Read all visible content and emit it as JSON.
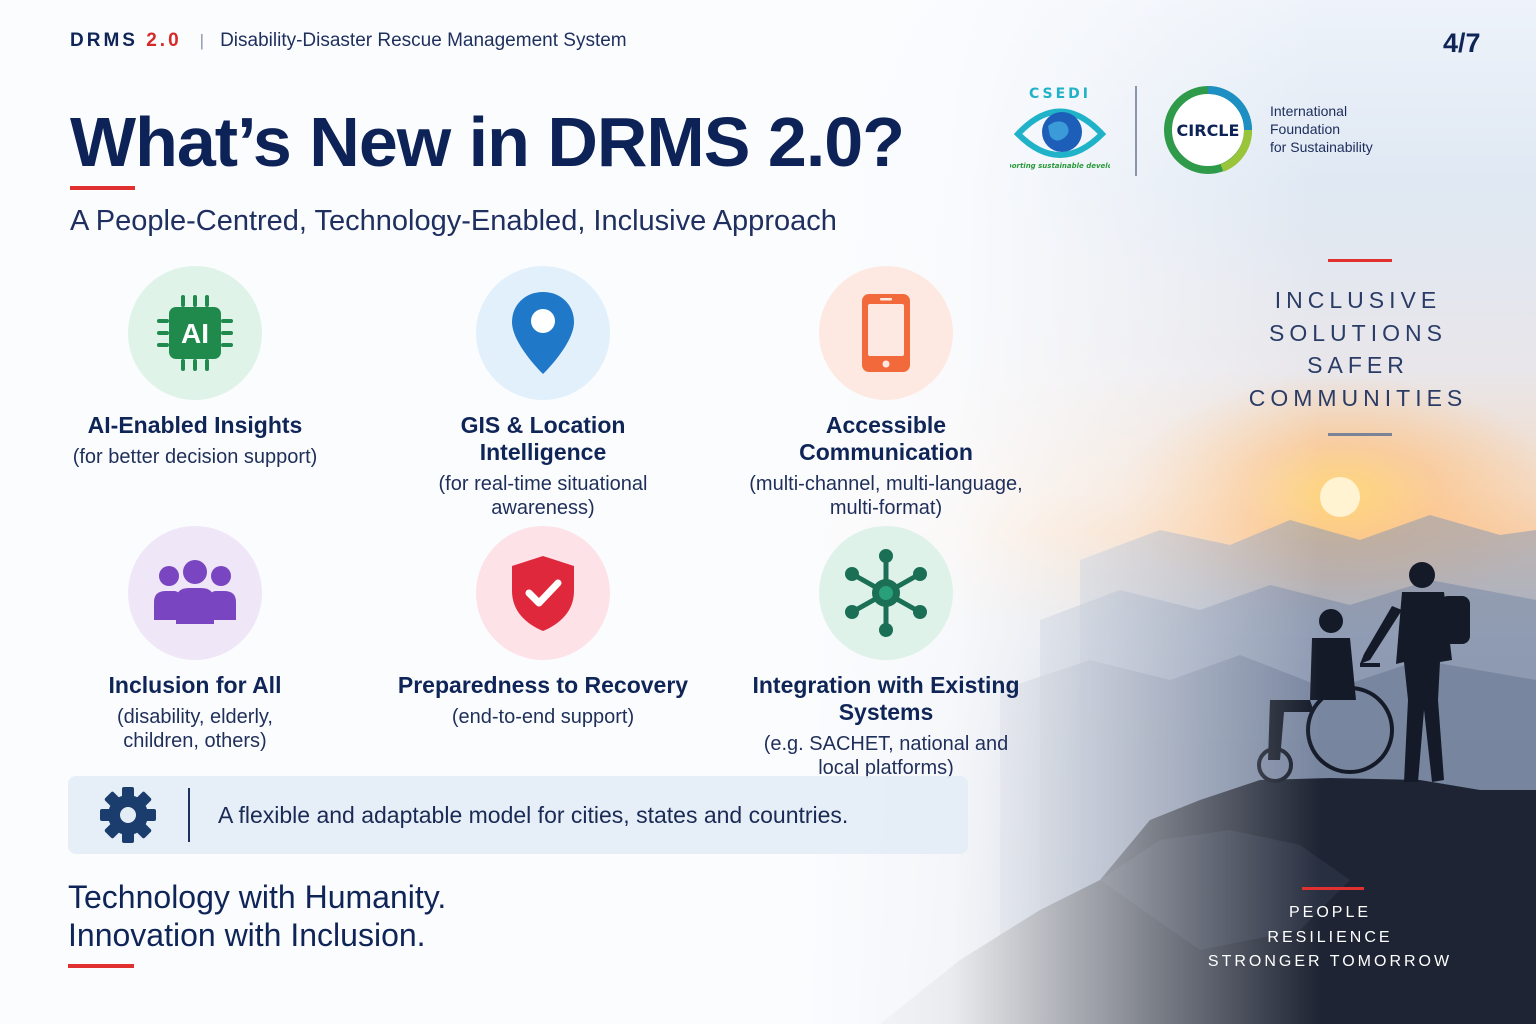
{
  "header": {
    "brand": "DRMS",
    "brand_version": "2.0",
    "separator": "|",
    "system_name": "Disability-Disaster Rescue Management System",
    "page_indicator": "4/7"
  },
  "title": "What’s New in DRMS 2.0?",
  "tagline": "A People-Centred, Technology-Enabled, Inclusive Approach",
  "logos": {
    "csedi_letters": "CSEDI",
    "csedi_caption": "... supporting sustainable development",
    "circle_text": "CIRCLE",
    "foundation_line1": "International",
    "foundation_line2": "Foundation",
    "foundation_line3": "for Sustainability"
  },
  "features": [
    {
      "icon": "ai-chip-icon",
      "title": "AI-Enabled Insights",
      "desc": "(for better decision support)",
      "icon_label": "AI",
      "color": "#1f8a4c",
      "bg": "#dff3e8"
    },
    {
      "icon": "map-pin-icon",
      "title": "GIS & Location Intelligence",
      "desc": "(for real-time situational awareness)",
      "color": "#1f78c8",
      "bg": "#e2f0fb"
    },
    {
      "icon": "smartphone-icon",
      "title": "Accessible Communication",
      "desc": "(multi-channel, multi-language, multi-format)",
      "color": "#f26a3c",
      "bg": "#fde9e1"
    },
    {
      "icon": "group-people-icon",
      "title": "Inclusion for All",
      "desc": "(disability, elderly, children, others)",
      "color": "#7a45c0",
      "bg": "#efe6f8"
    },
    {
      "icon": "shield-check-icon",
      "title": "Preparedness to Recovery",
      "desc": "(end-to-end support)",
      "color": "#e0283c",
      "bg": "#fde2e8"
    },
    {
      "icon": "network-hub-icon",
      "title": "Integration with Existing Systems",
      "desc": "(e.g. SACHET, national and local platforms)",
      "color": "#1a6f55",
      "bg": "#dff2ea"
    }
  ],
  "banner": {
    "icon": "gear-icon",
    "text": "A flexible and adaptable model for cities, states and countries."
  },
  "closing": {
    "line1": "Technology with Humanity.",
    "line2": "Innovation with Inclusion."
  },
  "right_panel": {
    "lines": [
      "INCLUSIVE",
      "SOLUTIONS",
      "SAFER",
      "COMMUNITIES"
    ],
    "footer_lines": [
      "PEOPLE",
      "RESILIENCE",
      "STRONGER TOMORROW"
    ]
  },
  "colors": {
    "navy": "#0d2358",
    "accent_red": "#e03030"
  }
}
